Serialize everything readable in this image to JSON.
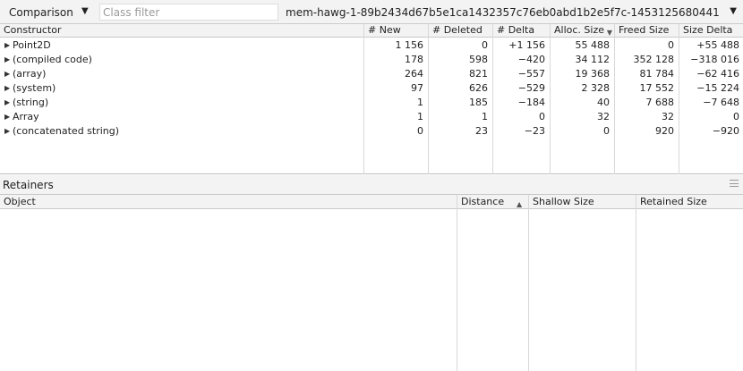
{
  "toolbar": {
    "view_label": "Comparison",
    "filter_placeholder": "Class filter",
    "filter_value": "",
    "snapshot_label": "mem-hawg-1-89b2434d67b5e1ca1432357c76eb0abd1b2e5f7c-1453125680441"
  },
  "table": {
    "columns": [
      "Constructor",
      "# New",
      "# Deleted",
      "# Delta",
      "Alloc. Size",
      "Freed Size",
      "Size Delta"
    ],
    "sorted_column": "Alloc. Size",
    "rows": [
      {
        "name": "Point2D",
        "new": "1 156",
        "deleted": "0",
        "delta": "+1 156",
        "alloc": "55 488",
        "freed": "0",
        "size_delta": "+55 488"
      },
      {
        "name": "(compiled code)",
        "new": "178",
        "deleted": "598",
        "delta": "−420",
        "alloc": "34 112",
        "freed": "352 128",
        "size_delta": "−318 016"
      },
      {
        "name": "(array)",
        "new": "264",
        "deleted": "821",
        "delta": "−557",
        "alloc": "19 368",
        "freed": "81 784",
        "size_delta": "−62 416"
      },
      {
        "name": "(system)",
        "new": "97",
        "deleted": "626",
        "delta": "−529",
        "alloc": "2 328",
        "freed": "17 552",
        "size_delta": "−15 224"
      },
      {
        "name": "(string)",
        "new": "1",
        "deleted": "185",
        "delta": "−184",
        "alloc": "40",
        "freed": "7 688",
        "size_delta": "−7 648"
      },
      {
        "name": "Array",
        "new": "1",
        "deleted": "1",
        "delta": "0",
        "alloc": "32",
        "freed": "32",
        "size_delta": "0"
      },
      {
        "name": "(concatenated string)",
        "new": "0",
        "deleted": "23",
        "delta": "−23",
        "alloc": "0",
        "freed": "920",
        "size_delta": "−920"
      }
    ]
  },
  "retainers": {
    "title": "Retainers",
    "columns": [
      "Object",
      "Distance",
      "Shallow Size",
      "Retained Size"
    ],
    "sorted_column": "Distance"
  },
  "icons": {
    "view_dropdown": "chevron-down-icon",
    "snapshot_dropdown": "chevron-down-icon",
    "row_expand": "triangle-right-icon",
    "sort_desc": "sort-down-icon",
    "sort_asc": "sort-up-icon",
    "panel_menu": "menu-icon"
  },
  "colors": {
    "accent": "#4d8af0",
    "toolbar_bg": "#f3f3f3",
    "border": "#c8c8c8"
  }
}
